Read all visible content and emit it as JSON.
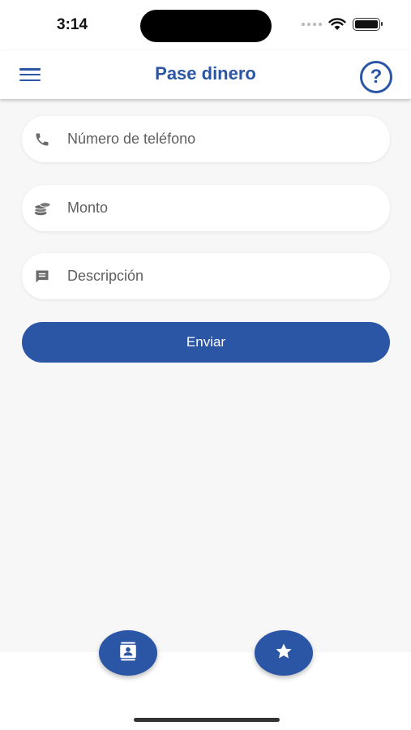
{
  "status_bar": {
    "time": "3:14"
  },
  "header": {
    "title": "Pase dinero",
    "help_label": "?"
  },
  "form": {
    "phone": {
      "placeholder": "Número de teléfono",
      "value": ""
    },
    "amount": {
      "placeholder": "Monto",
      "value": ""
    },
    "description": {
      "placeholder": "Descripción",
      "value": ""
    },
    "submit_label": "Enviar"
  },
  "colors": {
    "primary": "#2a56a5",
    "background": "#f7f7f7",
    "icon_gray": "#6b6b6b"
  },
  "icons": {
    "menu": "menu-icon",
    "help": "help-icon",
    "phone": "phone-icon",
    "amount": "coins-icon",
    "description": "message-icon",
    "contacts": "contacts-icon",
    "favorites": "star-icon"
  }
}
